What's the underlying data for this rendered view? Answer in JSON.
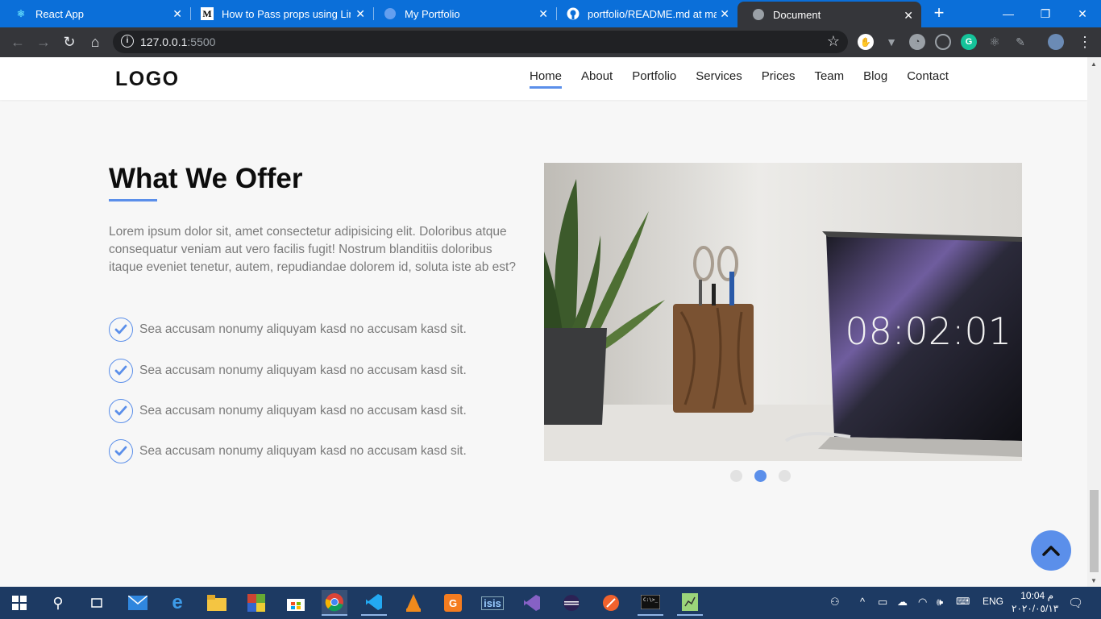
{
  "browser": {
    "tabs": [
      {
        "title": "React App",
        "icon": "react-icon"
      },
      {
        "title": "How to Pass props using Link a",
        "icon": "medium-icon"
      },
      {
        "title": "My Portfolio",
        "icon": "globe-icon"
      },
      {
        "title": "portfolio/README.md at maste",
        "icon": "github-icon"
      },
      {
        "title": "Document",
        "icon": "globe-icon"
      }
    ],
    "new_tab": "+",
    "url_host": "127.0.0.1",
    "url_port": ":5500"
  },
  "site": {
    "logo": "LOGO",
    "nav": [
      "Home",
      "About",
      "Portfolio",
      "Services",
      "Prices",
      "Team",
      "Blog",
      "Contact"
    ],
    "active_nav": "Home"
  },
  "offer": {
    "title": "What We Offer",
    "text": "Lorem ipsum dolor sit, amet consectetur adipisicing elit. Doloribus atque consequatur veniam aut vero facilis fugit! Nostrum blanditiis doloribus itaque eveniet tenetur, autem, repudiandae dolorem id, soluta iste ab est?",
    "features": [
      "Sea accusam nonumy aliquyam kasd no accusam kasd sit.",
      "Sea accusam nonumy aliquyam kasd no accusam kasd sit.",
      "Sea accusam nonumy aliquyam kasd no accusam kasd sit.",
      "Sea accusam nonumy aliquyam kasd no accusam kasd sit."
    ]
  },
  "slider": {
    "clock_text": "08:02:01",
    "dots": 3,
    "active_dot": 2
  },
  "taskbar": {
    "lang": "ENG",
    "time": "10:04 م",
    "date": "٢٠٢٠/٠٥/١٣"
  },
  "colors": {
    "accent": "#5b8fea",
    "chrome_tab_bar": "#0b6fd9",
    "chrome_toolbar": "#35363a",
    "taskbar": "#1d3a63"
  }
}
